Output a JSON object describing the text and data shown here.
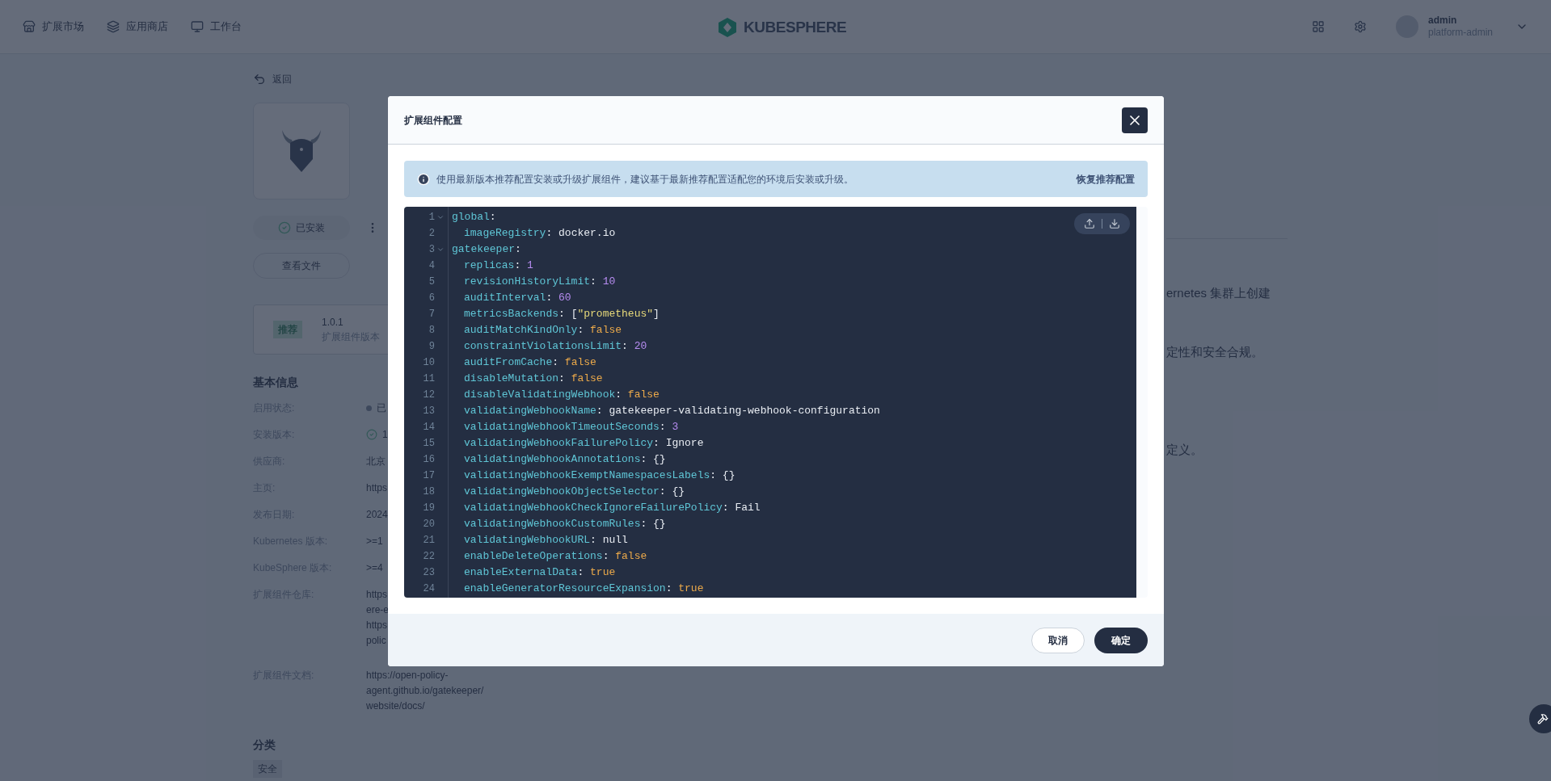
{
  "top_nav": {
    "items": [
      {
        "label": "扩展市场"
      },
      {
        "label": "应用商店"
      },
      {
        "label": "工作台"
      }
    ],
    "logo_text": "KUBESPHERE",
    "user": {
      "name": "admin",
      "role": "platform-admin"
    }
  },
  "page": {
    "back": "返回",
    "status_button": "已安装",
    "files_button": "查看文件",
    "version_card": {
      "badge": "推荐",
      "version": "1.0.1",
      "caption": "扩展组件版本"
    },
    "basic_info": {
      "title": "基本信息",
      "rows": [
        {
          "label": "启用状态:",
          "kind": "dot",
          "values": [
            "已"
          ]
        },
        {
          "label": "安装版本:",
          "kind": "check",
          "values": [
            "1"
          ]
        },
        {
          "label": "供应商:",
          "kind": "plain",
          "values": [
            "北京"
          ]
        },
        {
          "label": "主页:",
          "kind": "plain",
          "values": [
            "https"
          ]
        },
        {
          "label": "发布日期:",
          "kind": "plain",
          "values": [
            "2024"
          ]
        },
        {
          "label": "Kubernetes 版本:",
          "kind": "plain",
          "values": [
            ">=1"
          ]
        },
        {
          "label": "KubeSphere 版本:",
          "kind": "plain",
          "values": [
            ">=4"
          ]
        },
        {
          "label": "扩展组件仓库:",
          "kind": "plain",
          "values": [
            "https",
            "ere-e",
            "https",
            "polic"
          ]
        },
        {
          "label": "扩展组件文档:",
          "kind": "plain",
          "values": [
            "https://open-policy-",
            "agent.github.io/gatekeeper/",
            "website/docs/"
          ]
        }
      ]
    },
    "category": {
      "title": "分类",
      "tags": [
        "安全"
      ]
    },
    "description_fragments": [
      "ernetes 集群上创建",
      "定性和安全合规。",
      "定义。"
    ]
  },
  "modal": {
    "title": "扩展组件配置",
    "notice": "使用最新版本推荐配置安装或升级扩展组件，建议基于最新推荐配置适配您的环境后安装或升级。",
    "notice_link": "恢复推荐配置",
    "editor": {
      "lines": [
        {
          "number": "1",
          "expanded": true,
          "tokens": [
            {
              "text": "global",
              "kind": "key"
            },
            {
              "text": ":",
              "kind": "punct"
            }
          ],
          "children": [
            {
              "number": "2",
              "tokens": [
                {
                  "text": "imageRegistry",
                  "kind": "key"
                },
                {
                  "text": ": docker.io",
                  "kind": "punct"
                }
              ]
            }
          ]
        },
        {
          "number": "3",
          "expanded": true,
          "tokens": [
            {
              "text": "gatekeeper",
              "kind": "key"
            },
            {
              "text": ":",
              "kind": "punct"
            }
          ],
          "children": [
            {
              "number": "4",
              "tokens": [
                {
                  "text": "replicas",
                  "kind": "key"
                },
                {
                  "text": ": ",
                  "kind": "punct"
                },
                {
                  "text": "1",
                  "kind": "number"
                }
              ]
            },
            {
              "number": "5",
              "tokens": [
                {
                  "text": "revisionHistoryLimit",
                  "kind": "key"
                },
                {
                  "text": ": ",
                  "kind": "punct"
                },
                {
                  "text": "10",
                  "kind": "number"
                }
              ]
            },
            {
              "number": "6",
              "tokens": [
                {
                  "text": "auditInterval",
                  "kind": "key"
                },
                {
                  "text": ": ",
                  "kind": "punct"
                },
                {
                  "text": "60",
                  "kind": "number"
                }
              ]
            },
            {
              "number": "7",
              "tokens": [
                {
                  "text": "metricsBackends",
                  "kind": "key"
                },
                {
                  "text": ": [",
                  "kind": "punct"
                },
                {
                  "text": "\"prometheus\"",
                  "kind": "string"
                },
                {
                  "text": "]",
                  "kind": "punct"
                }
              ]
            },
            {
              "number": "8",
              "tokens": [
                {
                  "text": "auditMatchKindOnly",
                  "kind": "key"
                },
                {
                  "text": ": ",
                  "kind": "punct"
                },
                {
                  "text": "false",
                  "kind": "bool"
                }
              ]
            },
            {
              "number": "9",
              "tokens": [
                {
                  "text": "constraintViolationsLimit",
                  "kind": "key"
                },
                {
                  "text": ": ",
                  "kind": "punct"
                },
                {
                  "text": "20",
                  "kind": "number"
                }
              ]
            },
            {
              "number": "10",
              "tokens": [
                {
                  "text": "auditFromCache",
                  "kind": "key"
                },
                {
                  "text": ": ",
                  "kind": "punct"
                },
                {
                  "text": "false",
                  "kind": "bool"
                }
              ]
            },
            {
              "number": "11",
              "tokens": [
                {
                  "text": "disableMutation",
                  "kind": "key"
                },
                {
                  "text": ": ",
                  "kind": "punct"
                },
                {
                  "text": "false",
                  "kind": "bool"
                }
              ]
            },
            {
              "number": "12",
              "tokens": [
                {
                  "text": "disableValidatingWebhook",
                  "kind": "key"
                },
                {
                  "text": ": ",
                  "kind": "punct"
                },
                {
                  "text": "false",
                  "kind": "bool"
                }
              ]
            },
            {
              "number": "13",
              "tokens": [
                {
                  "text": "validatingWebhookName",
                  "kind": "key"
                },
                {
                  "text": ": gatekeeper-validating-webhook-configuration",
                  "kind": "punct"
                }
              ]
            },
            {
              "number": "14",
              "tokens": [
                {
                  "text": "validatingWebhookTimeoutSeconds",
                  "kind": "key"
                },
                {
                  "text": ": ",
                  "kind": "punct"
                },
                {
                  "text": "3",
                  "kind": "number"
                }
              ]
            },
            {
              "number": "15",
              "tokens": [
                {
                  "text": "validatingWebhookFailurePolicy",
                  "kind": "key"
                },
                {
                  "text": ": Ignore",
                  "kind": "punct"
                }
              ]
            },
            {
              "number": "16",
              "tokens": [
                {
                  "text": "validatingWebhookAnnotations",
                  "kind": "key"
                },
                {
                  "text": ": {}",
                  "kind": "punct"
                }
              ]
            },
            {
              "number": "17",
              "tokens": [
                {
                  "text": "validatingWebhookExemptNamespacesLabels",
                  "kind": "key"
                },
                {
                  "text": ": {}",
                  "kind": "punct"
                }
              ]
            },
            {
              "number": "18",
              "tokens": [
                {
                  "text": "validatingWebhookObjectSelector",
                  "kind": "key"
                },
                {
                  "text": ": {}",
                  "kind": "punct"
                }
              ]
            },
            {
              "number": "19",
              "tokens": [
                {
                  "text": "validatingWebhookCheckIgnoreFailurePolicy",
                  "kind": "key"
                },
                {
                  "text": ": Fail",
                  "kind": "punct"
                }
              ]
            },
            {
              "number": "20",
              "tokens": [
                {
                  "text": "validatingWebhookCustomRules",
                  "kind": "key"
                },
                {
                  "text": ": {}",
                  "kind": "punct"
                }
              ]
            },
            {
              "number": "21",
              "tokens": [
                {
                  "text": "validatingWebhookURL",
                  "kind": "key"
                },
                {
                  "text": ": null",
                  "kind": "punct"
                }
              ]
            },
            {
              "number": "22",
              "tokens": [
                {
                  "text": "enableDeleteOperations",
                  "kind": "key"
                },
                {
                  "text": ": ",
                  "kind": "punct"
                },
                {
                  "text": "false",
                  "kind": "bool"
                }
              ]
            },
            {
              "number": "23",
              "tokens": [
                {
                  "text": "enableExternalData",
                  "kind": "key"
                },
                {
                  "text": ": ",
                  "kind": "punct"
                },
                {
                  "text": "true",
                  "kind": "bool"
                }
              ]
            },
            {
              "number": "24",
              "tokens": [
                {
                  "text": "enableGeneratorResourceExpansion",
                  "kind": "key"
                },
                {
                  "text": ": ",
                  "kind": "punct"
                },
                {
                  "text": "true",
                  "kind": "bool"
                }
              ]
            }
          ]
        }
      ]
    },
    "buttons": [
      {
        "label": "取消",
        "kind": "secondary"
      },
      {
        "label": "确定",
        "kind": "primary"
      }
    ]
  }
}
